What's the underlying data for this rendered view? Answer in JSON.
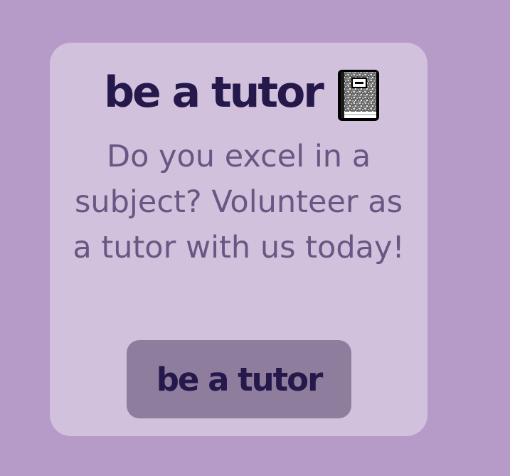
{
  "card": {
    "title": "be a tutor",
    "icon": "notebook-icon",
    "description": "Do you excel in a subject? Volunteer as a tutor with us today!",
    "button_label": "be a tutor"
  },
  "colors": {
    "background": "#b69bc9",
    "card": "#d2c1dc",
    "title_text": "#25184a",
    "body_text": "#6a5683",
    "button": "#8f7d9d"
  }
}
